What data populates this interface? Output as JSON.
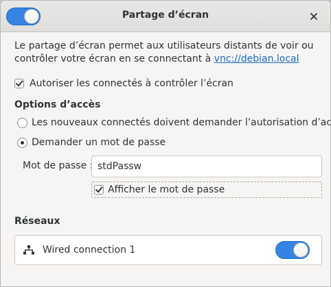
{
  "window": {
    "title": "Partage d’écran",
    "sharing_enabled": true
  },
  "description": {
    "text": "Le partage d’écran permet aux utilisateurs distants de voir ou contrôler votre écran en se connectant à ",
    "link": "vnc://debian.local"
  },
  "allow_control": {
    "label": "Autoriser les connectés à contrôler l’écran",
    "checked": true
  },
  "access_options": {
    "heading": "Options d’accès",
    "options": [
      {
        "label": "Les nouveaux connectés doivent demander l’autorisation d’accès",
        "selected": false
      },
      {
        "label": "Demander un mot de passe",
        "selected": true
      }
    ]
  },
  "password": {
    "label": "Mot de passe :",
    "value": "stdPassw",
    "show_label": "Afficher le mot de passe",
    "show_checked": true
  },
  "networks": {
    "heading": "Réseaux",
    "items": [
      {
        "name": "Wired connection 1",
        "enabled": true,
        "icon": "network-wired-icon"
      }
    ]
  },
  "colors": {
    "accent": "#3584e4",
    "link": "#1b6acb",
    "window_bg": "#f6f5f4",
    "text": "#2e3436"
  }
}
